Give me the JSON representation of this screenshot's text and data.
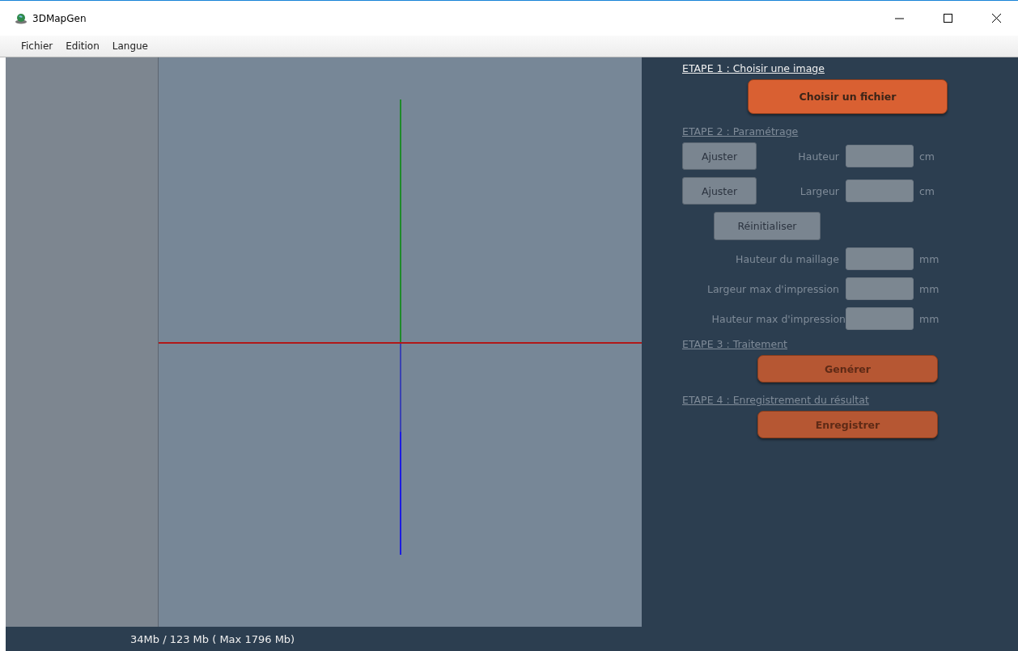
{
  "window": {
    "title": "3DMapGen"
  },
  "menu": [
    {
      "label": "Fichier"
    },
    {
      "label": "Edition"
    },
    {
      "label": "Langue"
    }
  ],
  "steps": [
    {
      "title": "ETAPE 1 : Choisir une image",
      "disabled": false,
      "rows": [
        {
          "kind": "primary",
          "label": "Choisir un fichier"
        }
      ]
    },
    {
      "title": "ETAPE 2 : Paramétrage",
      "disabled": true,
      "rows": [
        {
          "kind": "adjust",
          "button": "Ajuster",
          "label": "Hauteur",
          "unit": "cm"
        },
        {
          "kind": "adjust",
          "button": "Ajuster",
          "label": "Largeur",
          "unit": "cm"
        },
        {
          "kind": "button",
          "label": "Réinitialiser"
        },
        {
          "kind": "field",
          "label": "Hauteur du maillage",
          "unit": "mm"
        },
        {
          "kind": "field",
          "label": "Largeur max d'impression",
          "unit": "mm"
        },
        {
          "kind": "field",
          "label": "Hauteur max d'impression",
          "unit": "mm"
        }
      ]
    },
    {
      "title": "ETAPE 3 : Traitement",
      "disabled": true,
      "rows": [
        {
          "kind": "primary",
          "label": "Genérer"
        }
      ]
    },
    {
      "title": "ETAPE 4 : Enregistrement du résultat",
      "disabled": true,
      "rows": [
        {
          "kind": "primary",
          "label": "Enregistrer"
        }
      ]
    }
  ],
  "status": "34Mb / 123 Mb ( Max 1796 Mb)"
}
